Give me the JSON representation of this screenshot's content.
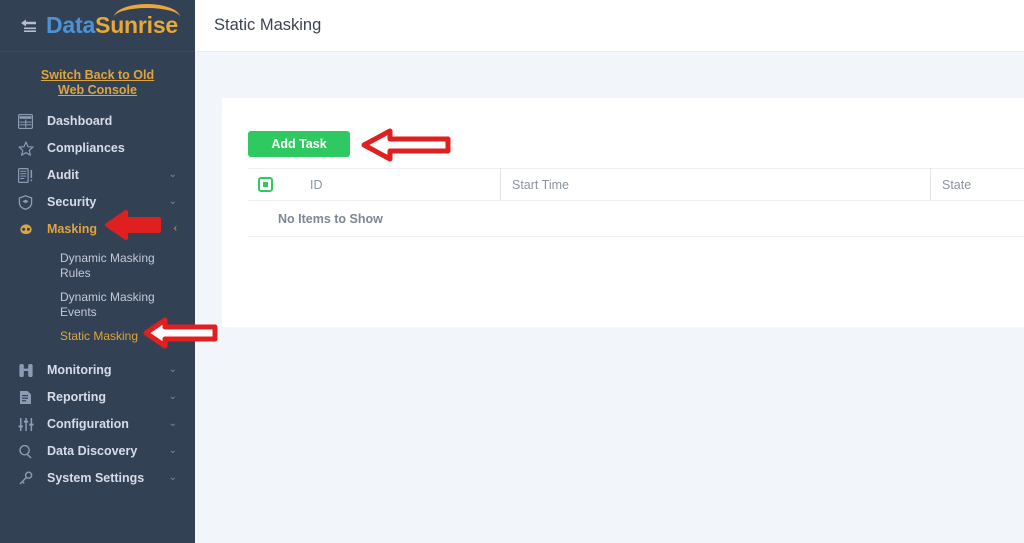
{
  "brand": {
    "logo_first": "Data",
    "logo_second": "Sunrise",
    "collapse_icon": "collapse-arrow-icon"
  },
  "sidebar": {
    "switch_link": "Switch Back to Old Web Console",
    "items": [
      {
        "label": "Dashboard",
        "icon": "grid-icon",
        "chevron": "",
        "active": false
      },
      {
        "label": "Compliances",
        "icon": "star-icon",
        "chevron": "",
        "active": false
      },
      {
        "label": "Audit",
        "icon": "audit-icon",
        "chevron": "⌄",
        "active": false
      },
      {
        "label": "Security",
        "icon": "shield-icon",
        "chevron": "⌄",
        "active": false
      },
      {
        "label": "Masking",
        "icon": "mask-icon",
        "chevron": "‹",
        "active": true
      },
      {
        "label": "Monitoring",
        "icon": "monitoring-icon",
        "chevron": "⌄",
        "active": false
      },
      {
        "label": "Reporting",
        "icon": "report-icon",
        "chevron": "⌄",
        "active": false
      },
      {
        "label": "Configuration",
        "icon": "sliders-icon",
        "chevron": "⌄",
        "active": false
      },
      {
        "label": "Data Discovery",
        "icon": "search-icon",
        "chevron": "⌄",
        "active": false
      },
      {
        "label": "System Settings",
        "icon": "settings-icon",
        "chevron": "⌄",
        "active": false
      }
    ],
    "masking_submenu": [
      {
        "label": "Dynamic Masking Rules",
        "active": false
      },
      {
        "label": "Dynamic Masking Events",
        "active": false
      },
      {
        "label": "Static Masking",
        "active": true
      }
    ]
  },
  "header": {
    "title": "Static Masking"
  },
  "main": {
    "add_task_label": "Add Task",
    "table": {
      "select_all_icon": "checkbox-icon",
      "columns": [
        "ID",
        "Start Time",
        "State"
      ],
      "empty_message": "No Items to Show",
      "rows": []
    }
  },
  "annotations": [
    {
      "name": "arrow-add-task",
      "points": "left"
    },
    {
      "name": "arrow-masking",
      "points": "left"
    },
    {
      "name": "arrow-static-masking",
      "points": "left"
    }
  ],
  "colors": {
    "sidebar_bg": "#334155",
    "accent_gold": "#e0a43c",
    "logo_blue": "#4b93d6",
    "green_button": "#2ec961",
    "annotation_red": "#e02020",
    "content_bg": "#f2f5f9"
  }
}
